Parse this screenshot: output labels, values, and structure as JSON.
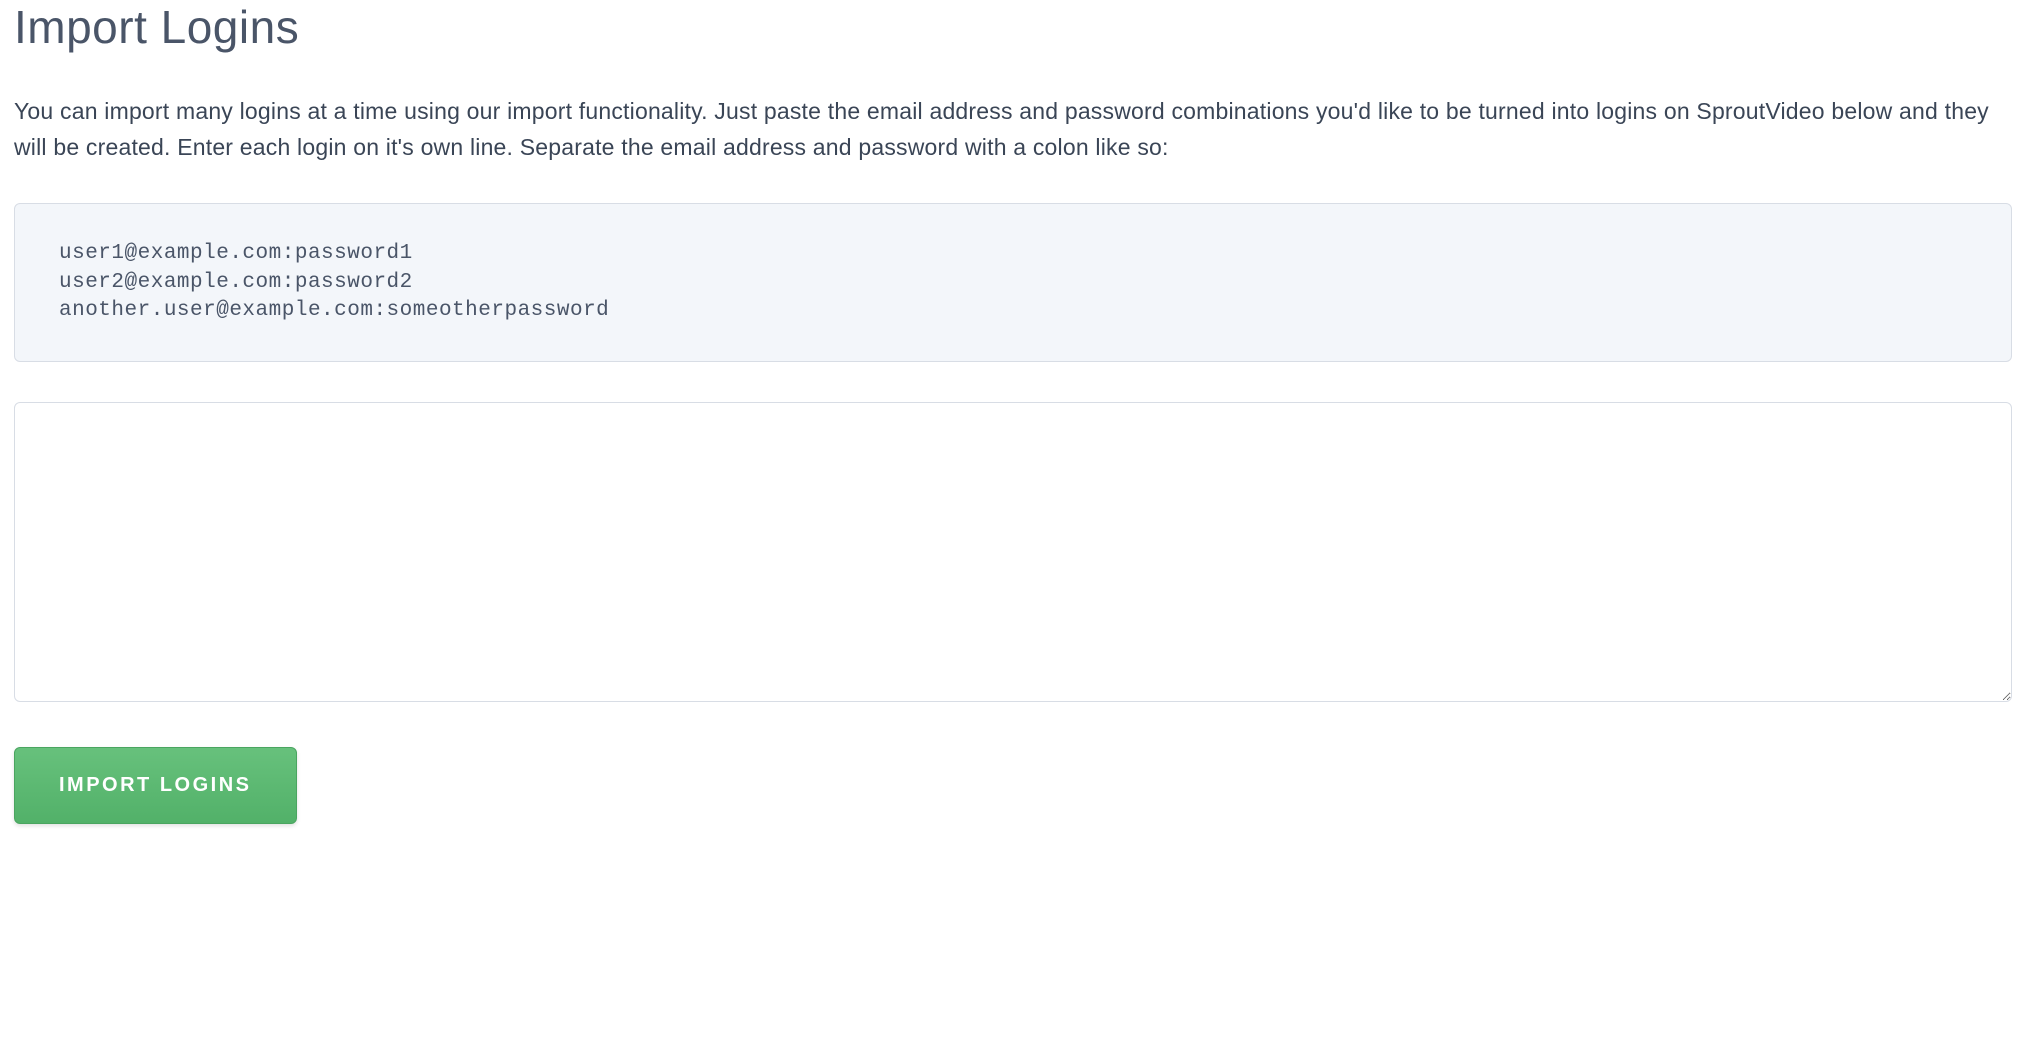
{
  "header": {
    "title": "Import Logins"
  },
  "main": {
    "description": "You can import many logins at a time using our import functionality. Just paste the email address and password combinations you'd like to be turned into logins on SproutVideo below and they will be created. Enter each login on it's own line. Separate the email address and password with a colon like so:",
    "example": "user1@example.com:password1\nuser2@example.com:password2\nanother.user@example.com:someotherpassword",
    "textarea_value": "",
    "button_label": "IMPORT LOGINS"
  }
}
